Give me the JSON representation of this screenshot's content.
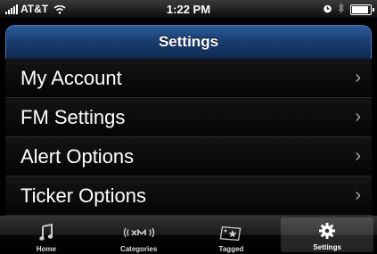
{
  "status_bar": {
    "carrier": "AT&T",
    "time": "1:22 PM"
  },
  "screen": {
    "title": "Settings",
    "items": [
      {
        "label": "My Account"
      },
      {
        "label": "FM Settings"
      },
      {
        "label": "Alert Options"
      },
      {
        "label": "Ticker Options"
      }
    ]
  },
  "tab_bar": {
    "selected": "Settings",
    "tabs": [
      {
        "label": "Home",
        "icon": "music-note-icon"
      },
      {
        "label": "Categories",
        "icon": "xm-radio-icon"
      },
      {
        "label": "Tagged",
        "icon": "star-tag-icon"
      },
      {
        "label": "Settings",
        "icon": "gear-icon"
      }
    ]
  }
}
